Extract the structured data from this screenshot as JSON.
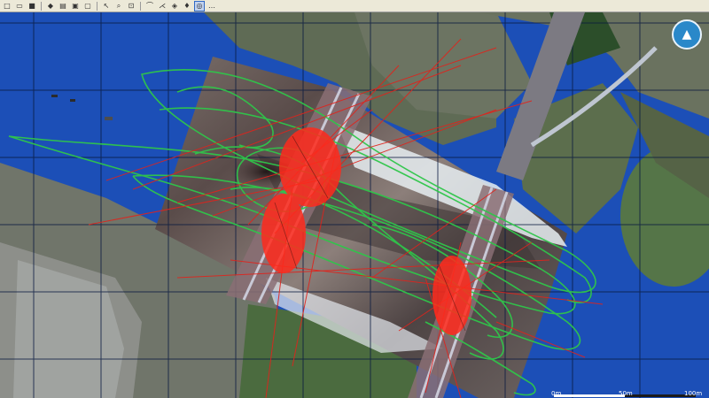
{
  "toolbar": {
    "buttons": [
      {
        "name": "new-document-icon",
        "glyph": "□"
      },
      {
        "name": "open-folder-icon",
        "glyph": "▭"
      },
      {
        "name": "save-icon",
        "glyph": "■"
      },
      {
        "name": "layers-icon",
        "glyph": "◆"
      },
      {
        "name": "print-icon",
        "glyph": "▤"
      },
      {
        "name": "export-icon",
        "glyph": "▣"
      },
      {
        "name": "copy-icon",
        "glyph": "▢"
      },
      {
        "name": "pointer-icon",
        "glyph": "↖"
      },
      {
        "name": "zoom-icon",
        "glyph": "⌕"
      },
      {
        "name": "zoom-extent-icon",
        "glyph": "⊡"
      },
      {
        "name": "measure-icon",
        "glyph": "⌒"
      },
      {
        "name": "ruler-icon",
        "glyph": "⋌"
      },
      {
        "name": "layer-toggle-icon",
        "glyph": "◈"
      },
      {
        "name": "marker-icon",
        "glyph": "♦"
      },
      {
        "name": "target-icon",
        "glyph": "◎"
      },
      {
        "name": "settings-icon",
        "glyph": "…"
      }
    ],
    "active_button": "target-icon"
  },
  "map": {
    "compass_glyph": "▲",
    "scale_labels": [
      "0m",
      "50m",
      "100m"
    ],
    "colors": {
      "water": "#1c4fb7",
      "grid": "#0a1a40",
      "track_green": "#2fc64a",
      "track_red": "#e0231c",
      "compass": "#2a88c9"
    }
  }
}
